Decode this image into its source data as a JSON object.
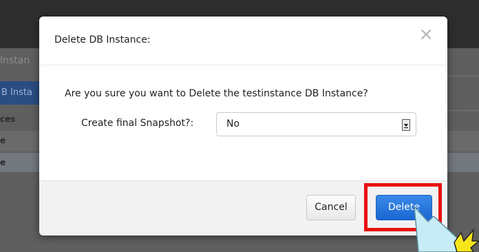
{
  "background": {
    "sidebar_title": "Instan",
    "sidebar_active_item": "B Insta",
    "sidebar_row_1": "ces",
    "sidebar_row_2": "e",
    "sidebar_row_3": "e"
  },
  "dialog": {
    "title": "Delete DB Instance:",
    "close_icon": "close-icon",
    "confirm_message": "Are you sure you want to Delete the testinstance DB Instance?",
    "snapshot_label": "Create final Snapshot?:",
    "snapshot_value": "No",
    "cancel_label": "Cancel",
    "delete_label": "Delete"
  },
  "colors": {
    "highlight": "#e81010",
    "primary_button": "#1a66d2",
    "pointer": "#c7ecf5",
    "pointer_star": "#f6e51a"
  }
}
